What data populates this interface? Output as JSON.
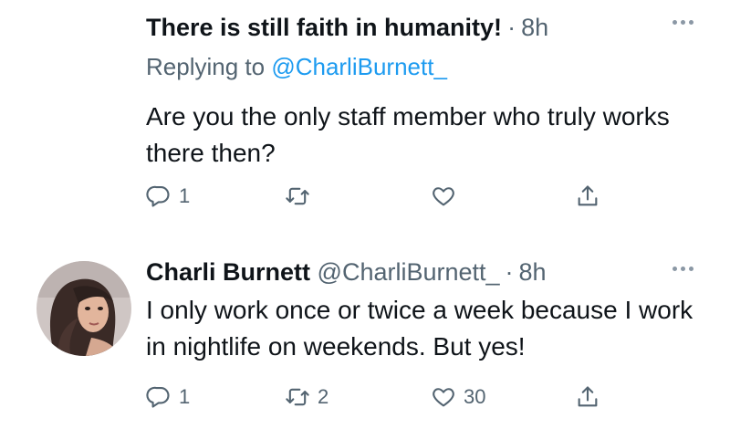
{
  "tweets": [
    {
      "name": "There is still faith in humanity!",
      "handle": "",
      "dot": "·",
      "time": "8h",
      "replying_prefix": "Replying to",
      "replying_to": "@CharliBurnett_",
      "text": "Are you the only staff member who truly works there then?",
      "reply_count": "1",
      "retweet_count": "",
      "like_count": ""
    },
    {
      "name": "Charli Burnett",
      "handle": "@CharliBurnett_",
      "dot": "·",
      "time": "8h",
      "text": "I only work once or twice a week because I work in nightlife on weekends. But yes!",
      "reply_count": "1",
      "retweet_count": "2",
      "like_count": "30"
    }
  ],
  "icons": {
    "reply": "reply-icon",
    "retweet": "retweet-icon",
    "like": "heart-icon",
    "share": "share-icon",
    "more": "more-icon"
  },
  "colors": {
    "text": "#0f1419",
    "secondary": "#536471",
    "link": "#1d9bf0"
  }
}
